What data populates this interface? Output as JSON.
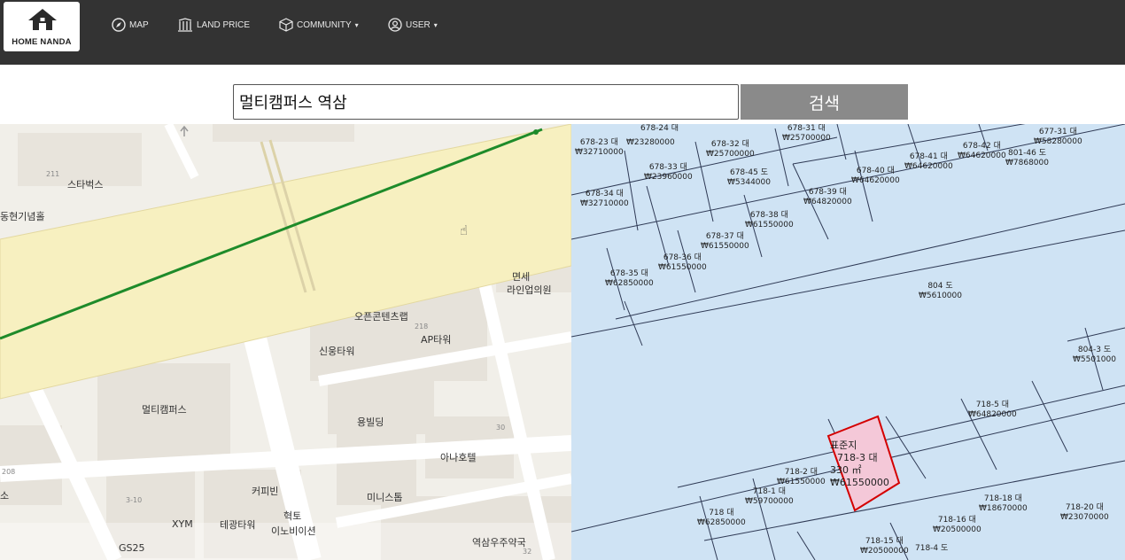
{
  "brand": {
    "name": "HOME NANDA"
  },
  "nav": [
    {
      "label": "MAP",
      "icon": "compass-icon"
    },
    {
      "label": "LAND PRICE",
      "icon": "columns-icon"
    },
    {
      "label": "COMMUNITY",
      "icon": "cube-icon"
    },
    {
      "label": "USER",
      "icon": "user-circle-icon"
    }
  ],
  "search": {
    "value": "멀티캠퍼스 역삼",
    "button": "검색"
  },
  "left_map": {
    "labels": [
      "스타벅스",
      "동현기념홀",
      "면세",
      "라인업의원",
      "오픈콘텐츠랩",
      "AP타워",
      "신웅타워",
      "멀티캠퍼스",
      "용빌딩",
      "아나호텔",
      "커피빈",
      "XYM",
      "테광타워",
      "혁토",
      "이노비이션",
      "미니스톱",
      "GS25",
      "역삼우주약국",
      "소"
    ],
    "small": [
      "211",
      "218",
      "208",
      "30",
      "3-10",
      "32"
    ]
  },
  "right_map": {
    "parcels": [
      {
        "id": "678-24 대",
        "price": ""
      },
      {
        "id": "678-23 대",
        "price": "₩32710000"
      },
      {
        "id": "",
        "price": "₩23280000"
      },
      {
        "id": "678-31 대",
        "price": "₩25700000"
      },
      {
        "id": "678-32 대",
        "price": "₩25700000"
      },
      {
        "id": "678-33 대",
        "price": "₩23960000"
      },
      {
        "id": "678-45 도",
        "price": "₩5344000"
      },
      {
        "id": "678-34 대",
        "price": "₩32710000"
      },
      {
        "id": "678-40 대",
        "price": "₩64620000"
      },
      {
        "id": "678-41 대",
        "price": "₩64620000"
      },
      {
        "id": "678-42 대",
        "price": "₩64620000"
      },
      {
        "id": "801-46 도",
        "price": "₩7868000"
      },
      {
        "id": "677-31 대",
        "price": "₩58280000"
      },
      {
        "id": "678-39 대",
        "price": "₩64820000"
      },
      {
        "id": "678-38 대",
        "price": "₩61550000"
      },
      {
        "id": "678-37 대",
        "price": "₩61550000"
      },
      {
        "id": "678-36 대",
        "price": "₩61550000"
      },
      {
        "id": "678-35 대",
        "price": "₩62850000"
      },
      {
        "id": "804 도",
        "price": "₩5610000"
      },
      {
        "id": "804-3 도",
        "price": "₩5501000"
      },
      {
        "id": "718-5 대",
        "price": "₩64820000"
      },
      {
        "id": "718-2 대",
        "price": "₩61550000"
      },
      {
        "id": "718-1 대",
        "price": "₩59700000"
      },
      {
        "id": "718 대",
        "price": "₩62850000"
      },
      {
        "id": "718-18 대",
        "price": "₩18670000"
      },
      {
        "id": "718-16 대",
        "price": "₩20500000"
      },
      {
        "id": "718-20 대",
        "price": "₩23070000"
      },
      {
        "id": "718-15 대",
        "price": "₩20500000"
      },
      {
        "id": "718-4 도",
        "price": ""
      }
    ],
    "selected": {
      "title": "표준지",
      "id": "718-3 대",
      "area": "330 ㎡",
      "price": "₩61550000"
    }
  },
  "colors": {
    "navbar": "#333333",
    "button": "#8a8a8a",
    "cadastral_bg": "#cfe3f4",
    "road": "#f7f0c0",
    "route": "#1e8b2a",
    "highlight": "#f4c8d8"
  }
}
